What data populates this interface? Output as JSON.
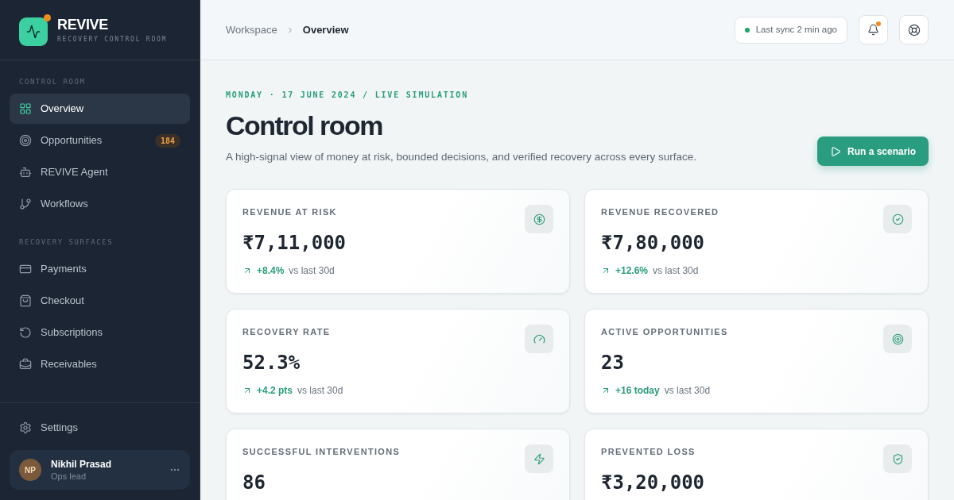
{
  "brand": {
    "name": "REVIVE",
    "tagline": "RECOVERY CONTROL ROOM",
    "alert": true
  },
  "sidebar": {
    "sections": [
      {
        "label": "CONTROL ROOM",
        "items": [
          {
            "label": "Overview",
            "selected": true
          },
          {
            "label": "Opportunities",
            "selected": false,
            "badge": "184"
          },
          {
            "label": "REVIVE Agent",
            "selected": false
          },
          {
            "label": "Workflows",
            "selected": false
          }
        ]
      },
      {
        "label": "RECOVERY SURFACES",
        "items": [
          {
            "label": "Payments",
            "selected": false
          },
          {
            "label": "Checkout",
            "selected": false
          },
          {
            "label": "Subscriptions",
            "selected": false
          },
          {
            "label": "Receivables",
            "selected": false
          }
        ]
      }
    ],
    "footer_items": [
      {
        "label": "Settings",
        "selected": false
      }
    ],
    "user": {
      "initials": "NP",
      "name": "Nikhil Prasad",
      "role": "Ops lead"
    }
  },
  "header": {
    "breadcrumb": [
      "Workspace",
      "Overview"
    ],
    "sync_status": "Last sync 2 min ago",
    "notifications_unread": true
  },
  "hero": {
    "eyebrow": "MONDAY · 17 JUNE 2024 / LIVE SIMULATION",
    "title": "Control room",
    "subtitle": "A high-signal view of money at risk, bounded decisions, and verified recovery across every surface.",
    "action": "Run a scenario"
  },
  "metrics": [
    {
      "label": "REVENUE AT RISK",
      "value": "₹7,11,000",
      "delta": "+8.4%",
      "comparison": "vs last 30d"
    },
    {
      "label": "REVENUE RECOVERED",
      "value": "₹7,80,000",
      "delta": "+12.6%",
      "comparison": "vs last 30d"
    },
    {
      "label": "RECOVERY RATE",
      "value": "52.3%",
      "delta": "+4.2 pts",
      "comparison": "vs last 30d"
    },
    {
      "label": "ACTIVE OPPORTUNITIES",
      "value": "23",
      "delta": "+16 today",
      "comparison": "vs last 30d"
    },
    {
      "label": "SUCCESSFUL INTERVENTIONS",
      "value": "86"
    },
    {
      "label": "PREVENTED LOSS",
      "value": "₹3,20,000"
    }
  ]
}
